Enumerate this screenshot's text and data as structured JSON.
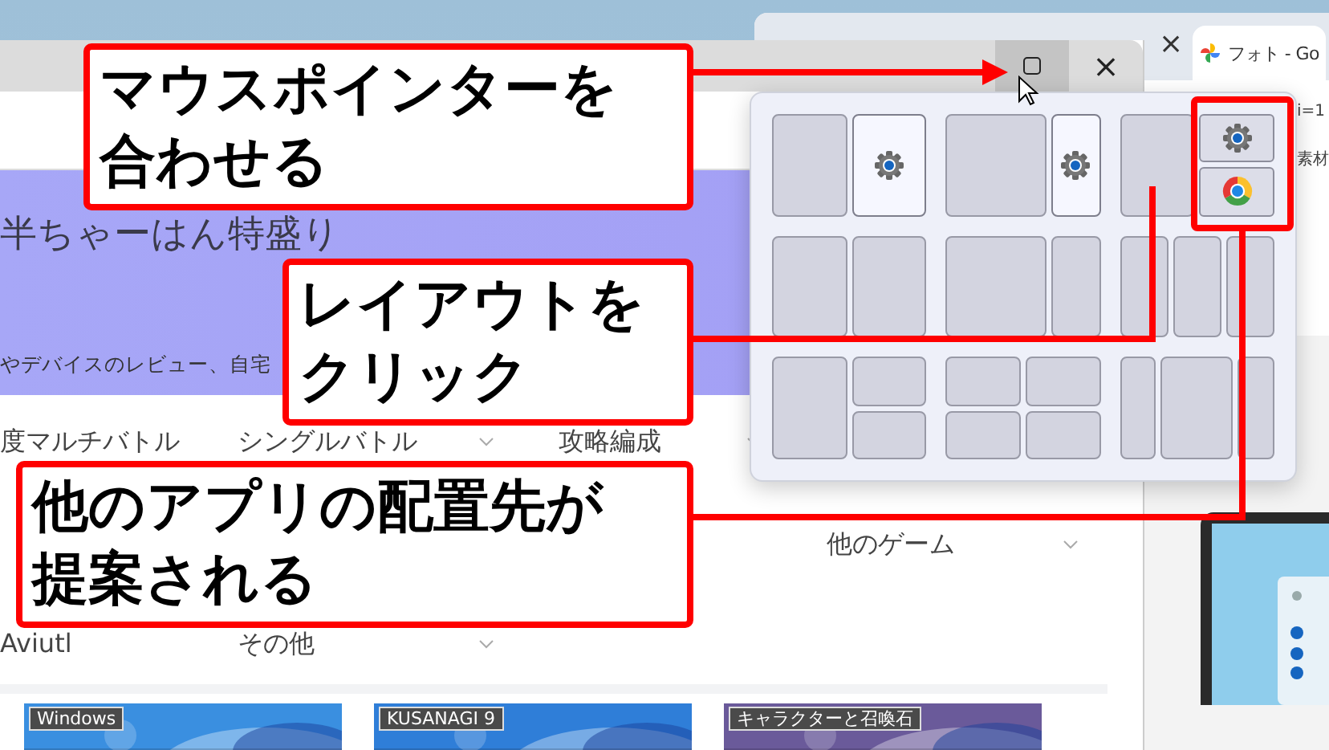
{
  "back_window": {
    "tab_close": "×",
    "active_tab": "フォト - Go",
    "texts": [
      "i=1",
      "素材"
    ]
  },
  "window": {
    "close": "×",
    "maximize_hovered": true,
    "banner": {
      "title": "半ちゃーはん特盛り",
      "subtitle": "やデバイスのレビュー、自宅"
    },
    "nav_rows": [
      [
        {
          "label": "度マルチバトル",
          "dropdown": false
        },
        {
          "label": "シングルバトル",
          "dropdown": true
        },
        {
          "label": "攻略編成",
          "dropdown": true
        }
      ],
      [
        {
          "label": "他のゲーム",
          "dropdown": true
        }
      ],
      [
        {
          "label": "Aviutl",
          "dropdown": false
        },
        {
          "label": "その他",
          "dropdown": true
        }
      ]
    ],
    "cards": [
      {
        "tag": "Windows",
        "color": "#3a8fe0"
      },
      {
        "tag": "KUSANAGI 9",
        "color": "#2f7ed8"
      },
      {
        "tag": "キャラクターと召喚石",
        "color": "#6a5a9a"
      }
    ]
  },
  "snap_layouts": [
    {
      "kind": "halves",
      "zones": [
        {
          "highlighted": false
        },
        {
          "highlighted": true,
          "apps": [
            {
              "kind": "gear"
            }
          ]
        }
      ]
    },
    {
      "kind": "two-thirds",
      "zones": [
        {
          "highlighted": false
        },
        {
          "highlighted": true,
          "apps": [
            {
              "kind": "gear"
            }
          ]
        }
      ]
    },
    {
      "kind": "halves",
      "zones": [
        {
          "highlighted": false
        },
        {
          "highlighted": false,
          "apps": [
            {
              "kind": "gear"
            },
            {
              "kind": "chrome"
            }
          ]
        }
      ]
    },
    {
      "kind": "halves",
      "zones": [
        {
          "highlighted": false
        },
        {
          "highlighted": false
        }
      ]
    },
    {
      "kind": "two-thirds",
      "zones": [
        {
          "highlighted": false
        },
        {
          "highlighted": false
        }
      ]
    },
    {
      "kind": "thirds",
      "zones": [
        {
          "highlighted": false
        },
        {
          "highlighted": false
        },
        {
          "highlighted": false
        }
      ]
    },
    {
      "kind": "half-stacked",
      "zones": [
        {
          "highlighted": false
        },
        {
          "highlighted": false
        },
        {
          "highlighted": false
        }
      ]
    },
    {
      "kind": "quad",
      "zones": [
        {
          "highlighted": false
        },
        {
          "highlighted": false
        },
        {
          "highlighted": false
        },
        {
          "highlighted": false
        }
      ]
    },
    {
      "kind": "quarter-half-quarter",
      "zones": [
        {
          "highlighted": false
        },
        {
          "highlighted": false
        },
        {
          "highlighted": false
        }
      ]
    }
  ],
  "callouts": [
    {
      "lines": [
        "マウスポインターを",
        "合わせる"
      ]
    },
    {
      "lines": [
        "レイアウトを",
        "クリック"
      ]
    },
    {
      "lines": [
        "他のアプリの配置先が",
        "提案される"
      ]
    }
  ]
}
